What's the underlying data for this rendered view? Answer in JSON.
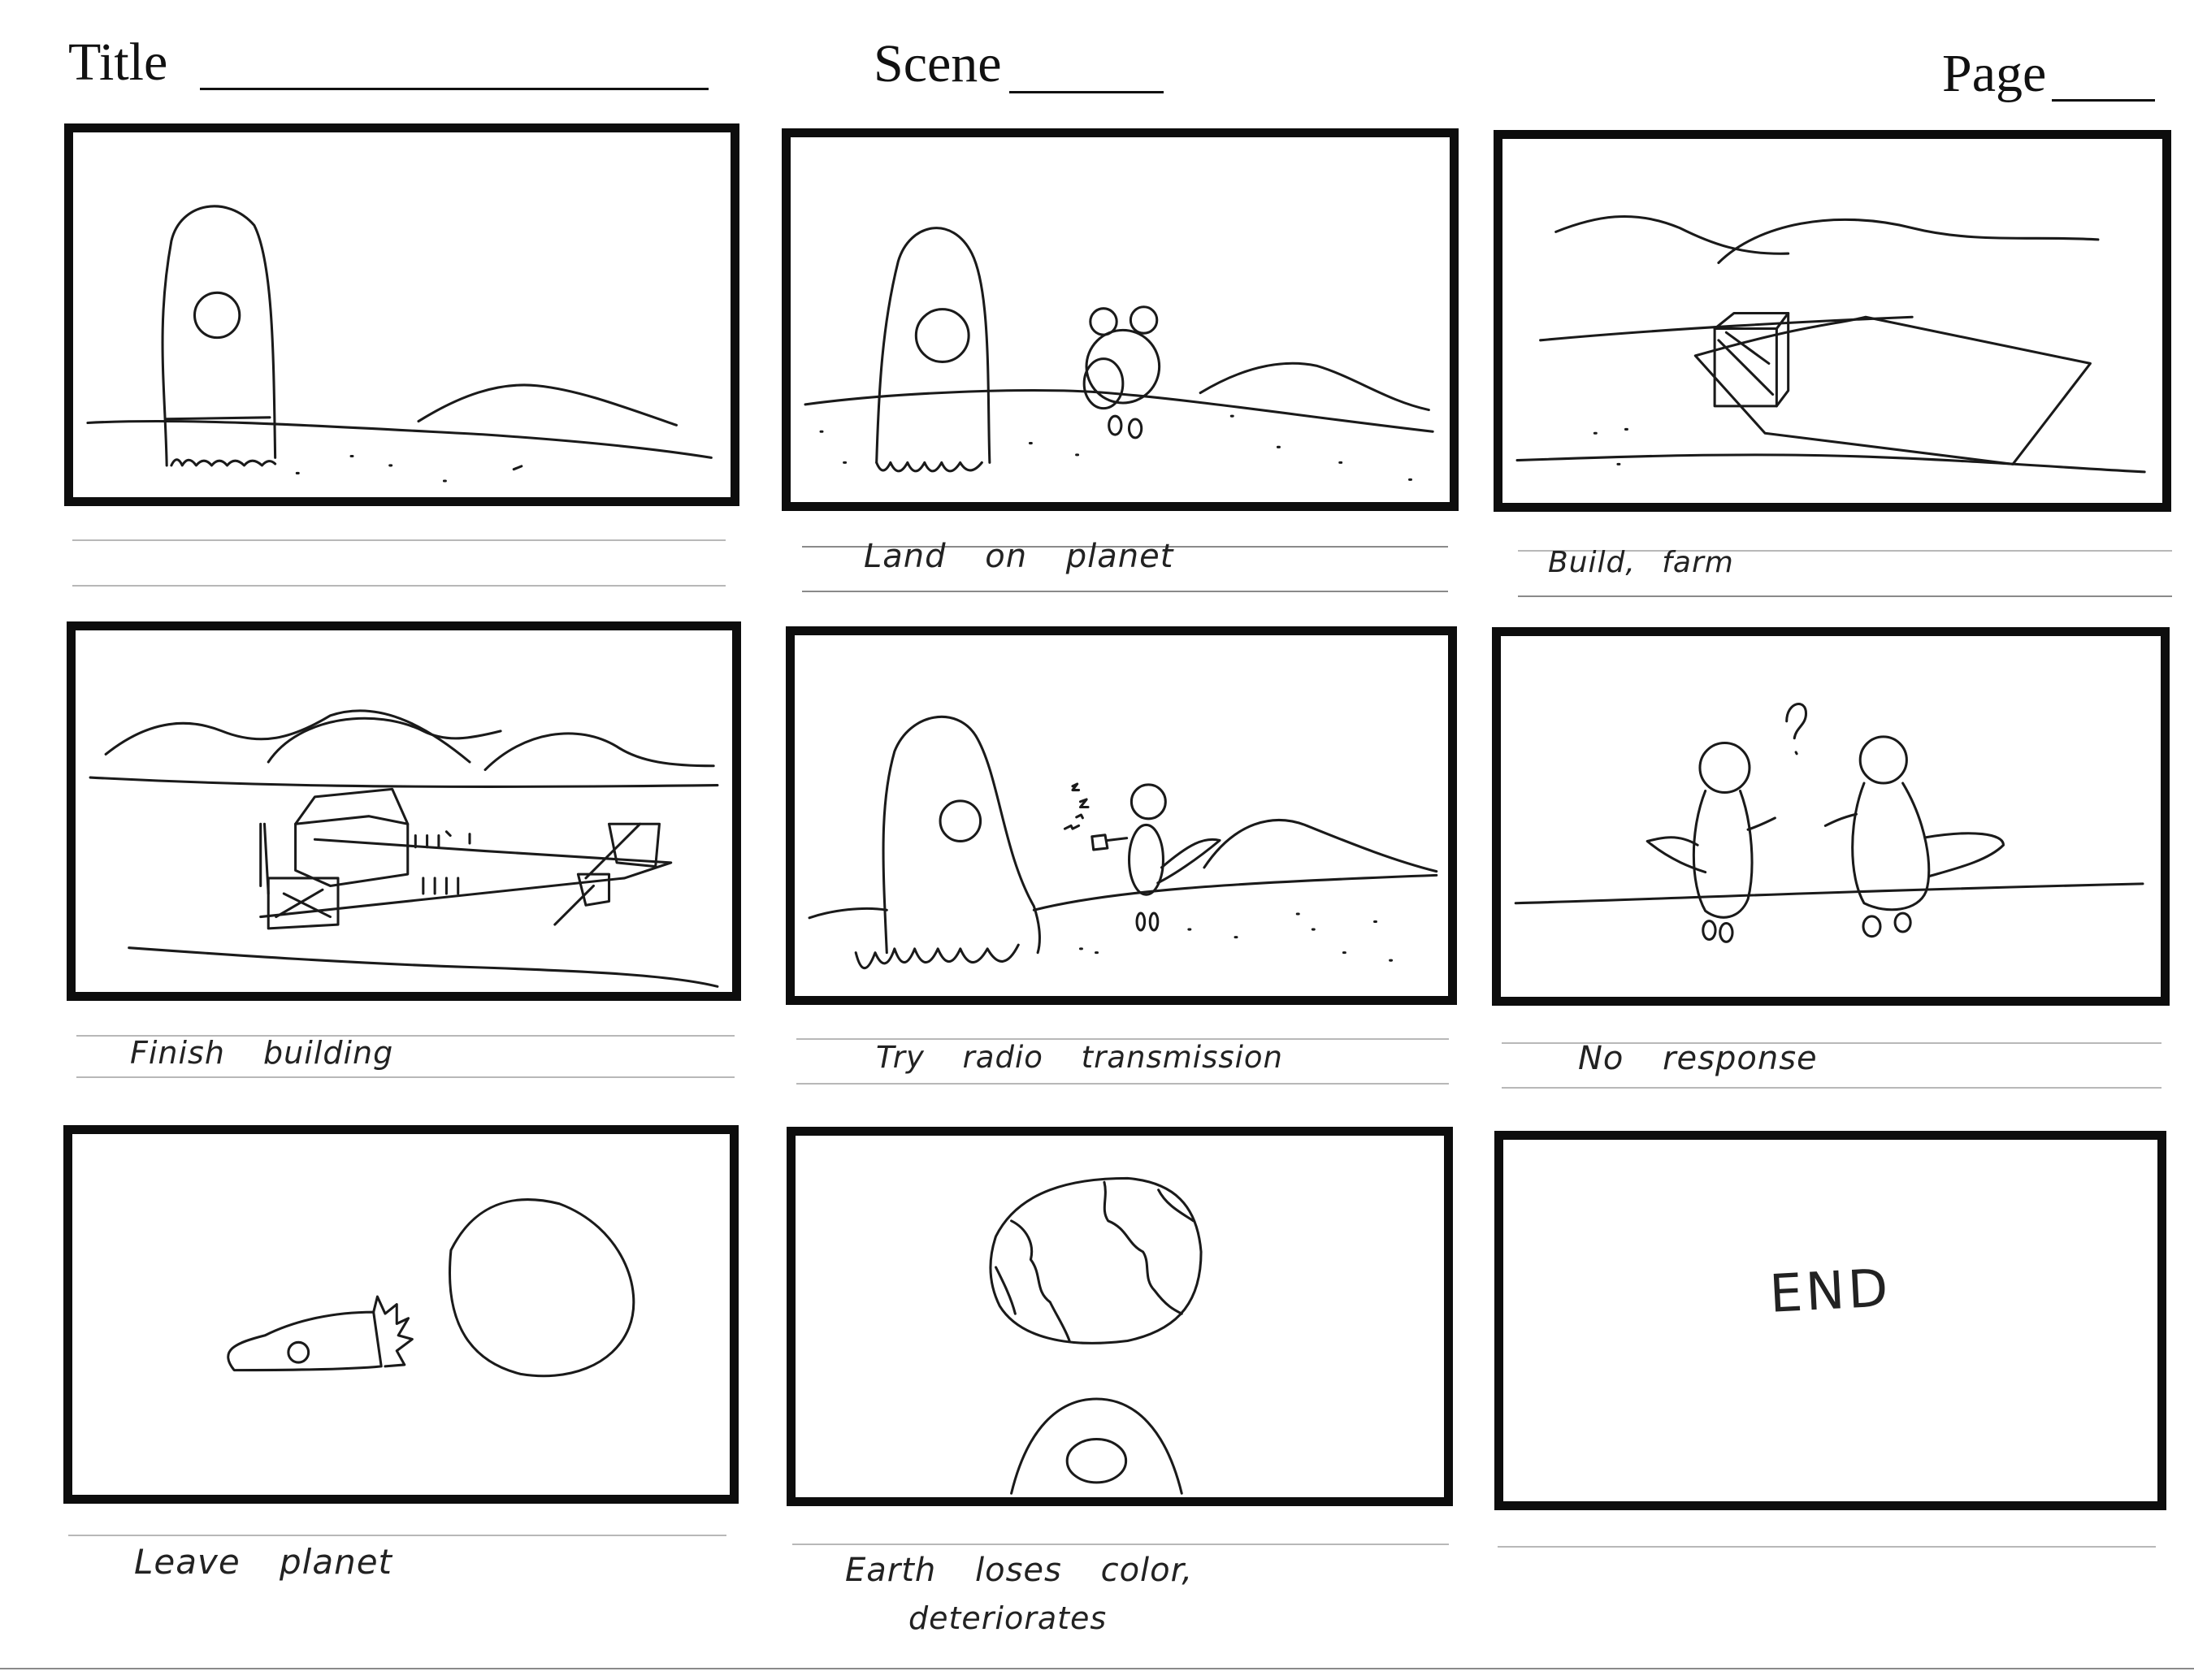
{
  "header": {
    "title_label": "Title",
    "scene_label": "Scene",
    "page_label": "Page"
  },
  "panels": [
    {
      "caption": ""
    },
    {
      "caption": "Land on planet"
    },
    {
      "caption": "Build, farm"
    },
    {
      "caption": "Finish building"
    },
    {
      "caption": "Try radio transmission"
    },
    {
      "caption": "No response"
    },
    {
      "caption": "Leave planet"
    },
    {
      "caption": "Earth loses color,",
      "caption_line2": "deteriorates"
    },
    {
      "caption": "",
      "text": "END"
    }
  ]
}
